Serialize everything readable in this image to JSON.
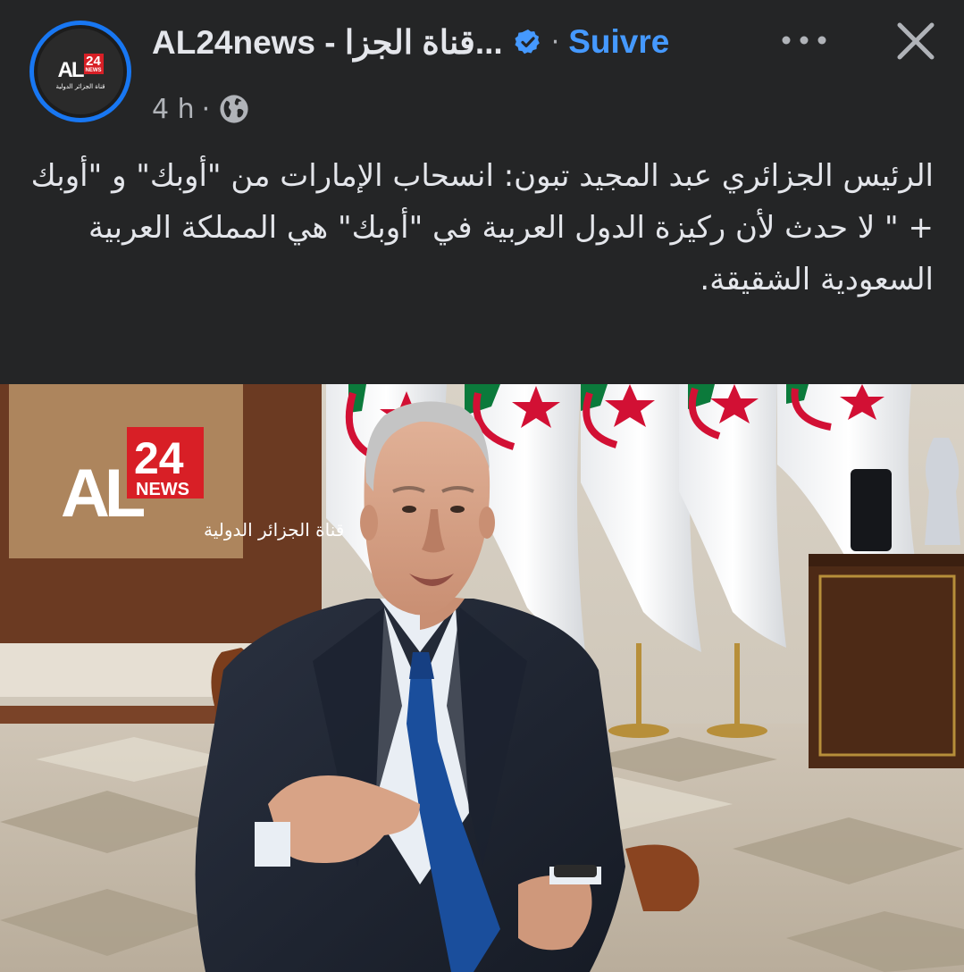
{
  "header": {
    "page_name": "AL24news - قناة الجزا...",
    "follow_label": "Suivre",
    "time": "4 h",
    "privacy_icon": "globe-icon",
    "verified_icon": "verified-badge-icon",
    "more_icon": "more-icon",
    "close_icon": "close-icon",
    "avatar": {
      "logo_text": "AL",
      "logo_number": "24",
      "logo_news": "NEWS",
      "logo_subtitle": "قناة الجزائر الدولية"
    }
  },
  "post": {
    "text": "الرئيس الجزائري عبد المجيد تبون: انسحاب الإمارات من \"أوبك\" و \"أوبك + \" لا حدث لأن ركيزة الدول العربية في \"أوبك\" هي المملكة العربية السعودية الشقيقة."
  },
  "photo": {
    "watermark": {
      "logo_text": "AL",
      "logo_number": "24",
      "logo_news": "NEWS",
      "subtitle": "قناة الجزائر الدولية"
    }
  },
  "colors": {
    "background": "#242526",
    "accent": "#4599ff",
    "avatar_ring": "#1877f2",
    "brand_red": "#d81f26"
  }
}
